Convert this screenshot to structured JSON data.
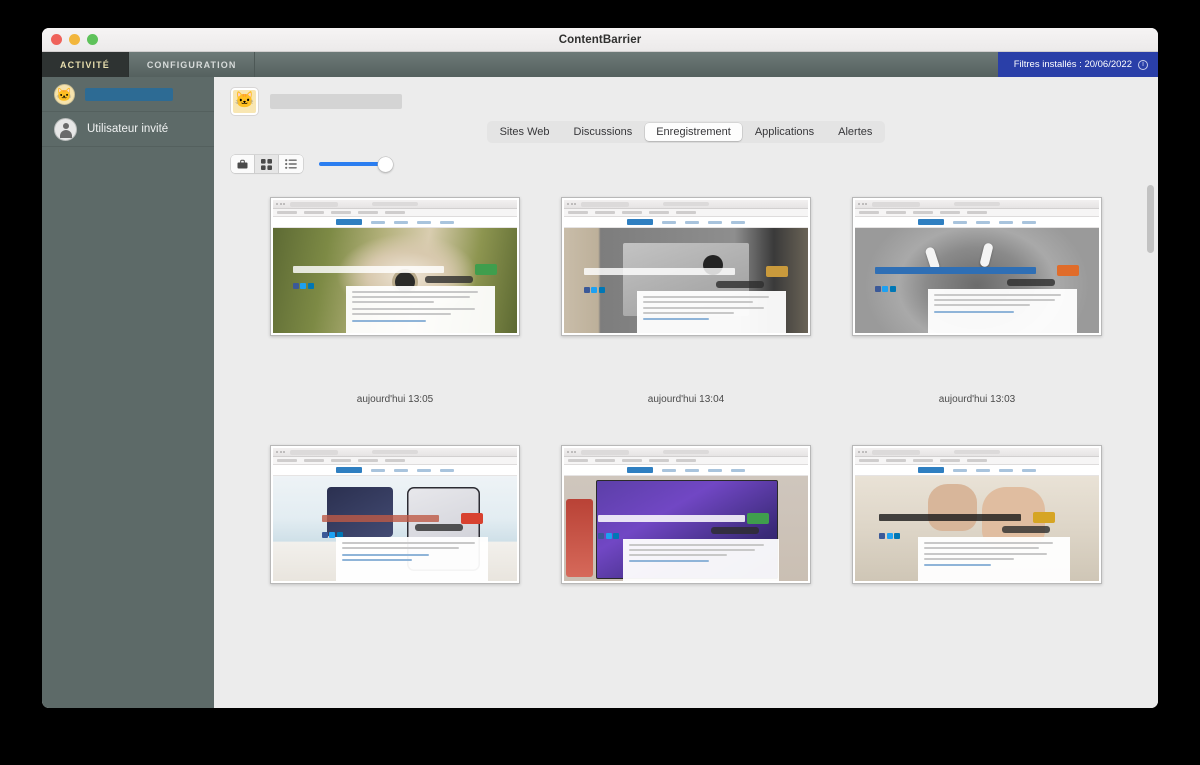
{
  "window": {
    "title": "ContentBarrier",
    "traffic_lights": [
      "close-red",
      "minimize-yellow",
      "zoom-green"
    ]
  },
  "main_tabs": [
    {
      "label": "ACTIVITÉ",
      "active": true
    },
    {
      "label": "CONFIGURATION",
      "active": false
    }
  ],
  "filter_badge": {
    "label": "Filtres installés : 20/06/2022",
    "icon": "info-icon",
    "color": "#2a3fa8"
  },
  "sidebar": {
    "background": "#5d6a68",
    "users": [
      {
        "name": "",
        "redacted": true,
        "avatar": "cat-emoji-avatar",
        "selected": true
      },
      {
        "name": "Utilisateur invité",
        "redacted": false,
        "avatar": "guest-person-icon",
        "selected": false
      }
    ]
  },
  "content_header": {
    "avatar": "cat-emoji-avatar",
    "name_redacted": true
  },
  "sub_tabs": [
    {
      "label": "Sites Web",
      "active": false
    },
    {
      "label": "Discussions",
      "active": false
    },
    {
      "label": "Enregistrement",
      "active": true
    },
    {
      "label": "Applications",
      "active": false
    },
    {
      "label": "Alertes",
      "active": false
    }
  ],
  "toolbar": {
    "view_modes": [
      {
        "icon": "briefcase-icon",
        "active": false
      },
      {
        "icon": "grid-view-icon",
        "active": true
      },
      {
        "icon": "list-view-icon",
        "active": false
      }
    ],
    "zoom_slider": {
      "value": 100,
      "min": 0,
      "max": 100,
      "accent": "#2b7ef0"
    }
  },
  "screenshots": [
    {
      "caption": "aujourd'hui 13:05",
      "scene": "ipad-pro-review",
      "accent": "#3f9e4d"
    },
    {
      "caption": "aujourd'hui 13:04",
      "scene": "apple-tv-remote-review",
      "accent": "#c99a3c"
    },
    {
      "caption": "aujourd'hui 13:03",
      "scene": "airpods-pro-review",
      "accent": "#e06c2a"
    },
    {
      "caption": "",
      "scene": "iphone-14-pro-max-review",
      "accent": "#d8412f"
    },
    {
      "caption": "",
      "scene": "macbook-pro-16-m1-max-review",
      "accent": "#3f9e4d"
    },
    {
      "caption": "",
      "scene": "youtube-video-review",
      "accent": "#d6a524"
    }
  ],
  "scrollbar": {
    "orientation": "vertical",
    "position": "top"
  }
}
